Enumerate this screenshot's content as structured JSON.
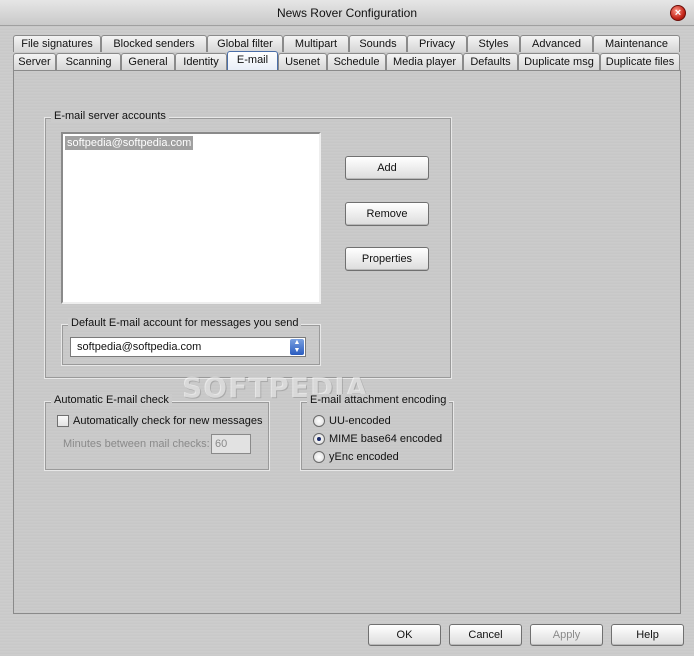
{
  "window": {
    "title": "News Rover Configuration",
    "close_glyph": "×"
  },
  "tabs_row1": [
    {
      "label": "File signatures"
    },
    {
      "label": "Blocked senders"
    },
    {
      "label": "Global filter"
    },
    {
      "label": "Multipart"
    },
    {
      "label": "Sounds"
    },
    {
      "label": "Privacy"
    },
    {
      "label": "Styles"
    },
    {
      "label": "Advanced"
    },
    {
      "label": "Maintenance"
    }
  ],
  "tabs_row2": [
    {
      "label": "Server"
    },
    {
      "label": "Scanning"
    },
    {
      "label": "General"
    },
    {
      "label": "Identity"
    },
    {
      "label": "E-mail",
      "active": true
    },
    {
      "label": "Usenet"
    },
    {
      "label": "Schedule"
    },
    {
      "label": "Media player"
    },
    {
      "label": "Defaults"
    },
    {
      "label": "Duplicate msg"
    },
    {
      "label": "Duplicate files"
    }
  ],
  "email_accounts": {
    "title": "E-mail server accounts",
    "items": [
      "softpedia@softpedia.com"
    ],
    "selected": "softpedia@softpedia.com",
    "add_label": "Add",
    "remove_label": "Remove",
    "properties_label": "Properties"
  },
  "default_account": {
    "title": "Default E-mail account for messages you send",
    "value": "softpedia@softpedia.com"
  },
  "auto_check": {
    "title": "Automatic E-mail check",
    "checkbox_label": "Automatically check for new messages",
    "checked": false,
    "minutes_label": "Minutes between mail checks:",
    "minutes_value": "60"
  },
  "encoding": {
    "title": "E-mail attachment encoding",
    "options": [
      "UU-encoded",
      "MIME base64 encoded",
      "yEnc encoded"
    ],
    "selected": "MIME base64 encoded"
  },
  "watermark": "SOFTPEDIA",
  "footer": {
    "ok_label": "OK",
    "cancel_label": "Cancel",
    "apply_label": "Apply",
    "help_label": "Help"
  },
  "icons": {
    "close": "close-icon",
    "dropdown": "chevron-down-icon"
  }
}
